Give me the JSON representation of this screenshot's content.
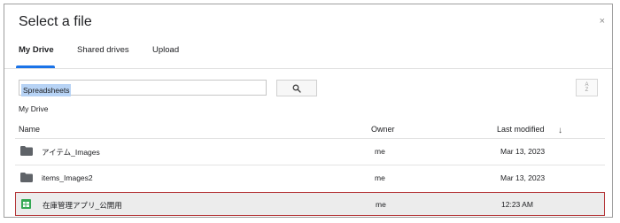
{
  "dialog": {
    "title": "Select a file",
    "close_glyph": "×"
  },
  "tabs": [
    {
      "label": "My Drive",
      "active": true
    },
    {
      "label": "Shared drives",
      "active": false
    },
    {
      "label": "Upload",
      "active": false
    }
  ],
  "search": {
    "value": "Spreadsheets",
    "button_icon": "search-icon"
  },
  "sort_button": {
    "top": "A",
    "bottom": "Z",
    "icon": "sort-az-icon"
  },
  "breadcrumb": "My Drive",
  "columns": {
    "name": "Name",
    "owner": "Owner",
    "last_modified": "Last modified",
    "sort_glyph": "↓"
  },
  "files": [
    {
      "name": "アイテム_Images",
      "owner": "me",
      "modified": "Mar 13, 2023",
      "icon": "folder-icon",
      "selected": false
    },
    {
      "name": "items_Images2",
      "owner": "me",
      "modified": "Mar 13, 2023",
      "icon": "folder-icon",
      "selected": false
    },
    {
      "name": "在庫管理アプリ_公開用",
      "owner": "me",
      "modified": "12:23 AM",
      "icon": "spreadsheet-icon",
      "selected": true
    }
  ],
  "colors": {
    "accent": "#1a73e8",
    "selection_border": "#b5393b",
    "spreadsheet_green": "#34a853"
  }
}
